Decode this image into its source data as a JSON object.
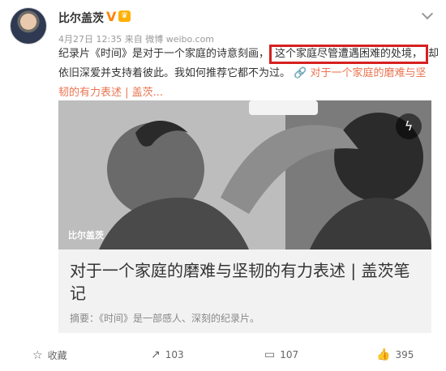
{
  "user": {
    "name": "比尔盖茨",
    "verified_icon": "V",
    "vip_icon": "vip"
  },
  "meta": {
    "date": "4月27日 12:35",
    "source": "来自 微博 weibo.com"
  },
  "post": {
    "line1_before": "纪录片《时间》是对于一个家庭的诗意刻画，",
    "line1_highlight": "这个家庭尽管遭遇困难的处境，",
    "line1_after": "却",
    "line2_text": "依旧深爱并支持着彼此。我如何推荐它都不为过。",
    "line2_link_icon": "🔗",
    "line2_link": "对于一个家庭的磨难与坚",
    "line3_link": "韧的有力表述 | 盖茨..."
  },
  "card": {
    "watermark": "比尔盖茨",
    "title": "对于一个家庭的磨难与坚韧的有力表述 | 盖茨笔记",
    "summary": "摘要：《时间》是一部感人、深刻的纪录片。",
    "lightning_icon": "ϟ"
  },
  "actions": {
    "favorite": "收藏",
    "repost_count": "103",
    "comment_count": "107",
    "like_count": "395"
  }
}
